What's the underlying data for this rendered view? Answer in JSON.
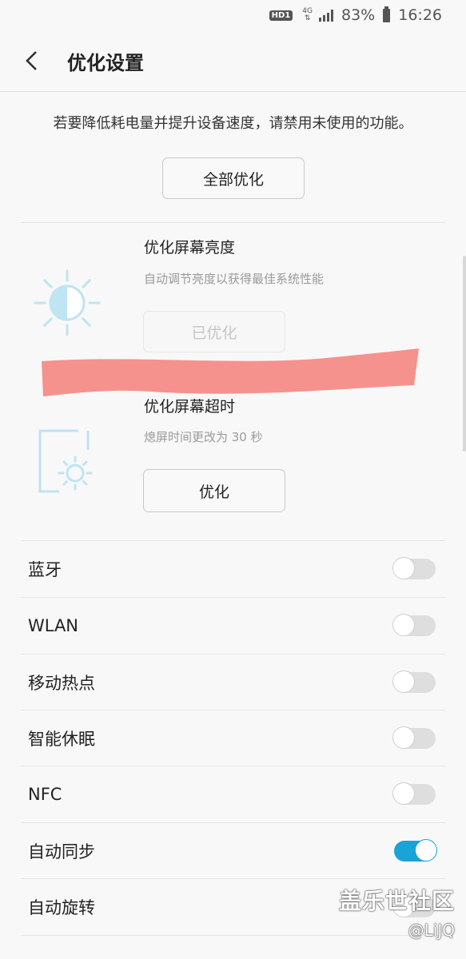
{
  "status_bar": {
    "hd_badge": "HD1",
    "network": "4G",
    "battery": "83%",
    "time": "16:26"
  },
  "header": {
    "title": "优化设置"
  },
  "intro": {
    "description": "若要降低耗电量并提升设备速度，请禁用未使用的功能。",
    "optimize_all_label": "全部优化"
  },
  "optimizations": [
    {
      "title": "优化屏幕亮度",
      "subtitle": "自动调节亮度以获得最佳系统性能",
      "button_label": "已优化",
      "button_enabled": false,
      "icon": "brightness-icon"
    },
    {
      "title": "优化屏幕超时",
      "subtitle": "熄屏时间更改为 30 秒",
      "button_label": "优化",
      "button_enabled": true,
      "icon": "screen-timeout-icon"
    }
  ],
  "toggles": [
    {
      "label": "蓝牙",
      "on": false
    },
    {
      "label": "WLAN",
      "on": false
    },
    {
      "label": "移动热点",
      "on": false
    },
    {
      "label": "智能休眠",
      "on": false
    },
    {
      "label": "NFC",
      "on": false
    },
    {
      "label": "自动同步",
      "on": true
    },
    {
      "label": "自动旋转",
      "on": false
    }
  ],
  "colors": {
    "accent": "#1aa3d6",
    "icon_light_blue": "#bfe4f2",
    "redaction": "#f4807a"
  },
  "watermark": {
    "line1": "盖乐世社区",
    "line2": "@LiJQ"
  }
}
